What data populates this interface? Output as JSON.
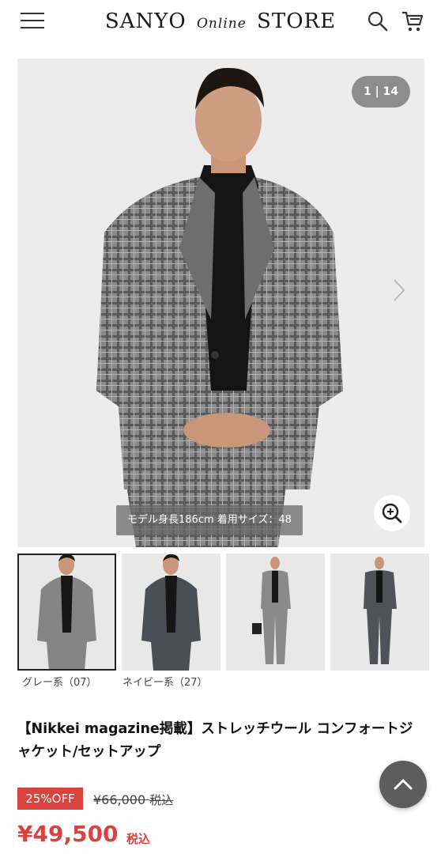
{
  "header": {
    "logo_brand": "SANYO",
    "logo_online": "Online",
    "logo_store": "STORE",
    "icons": [
      "menu-icon",
      "search-icon",
      "cart-icon"
    ]
  },
  "gallery": {
    "counter": "1 | 14",
    "caption": "モデル身長186cm 着用サイズ：48",
    "icons": [
      "chevron-right-icon",
      "zoom-in-icon"
    ]
  },
  "thumbnails": [
    {
      "label": "グレー系（07）",
      "selected": true
    },
    {
      "label": "ネイビー系（27）",
      "selected": false
    },
    {
      "label": "",
      "selected": false
    },
    {
      "label": "",
      "selected": false
    }
  ],
  "product": {
    "title": "【Nikkei magazine掲載】ストレッチウール コンフォートジャケット/セットアップ",
    "discount_badge": "25%OFF",
    "original_price": "¥66,000",
    "original_price_tax": "税込",
    "price": "¥49,500",
    "price_tax": "税込"
  },
  "colors": {
    "sale_red": "#d8433e",
    "counter_bg": "#8d8d8d",
    "scroll_top_bg": "#5d5d5d"
  }
}
